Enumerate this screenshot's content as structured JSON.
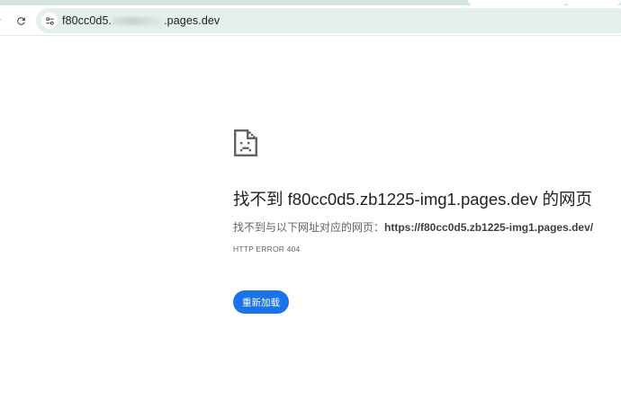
{
  "browser": {
    "url_prefix": "f80cc0d5.",
    "url_suffix": ".pages.dev"
  },
  "error_page": {
    "title": "找不到 f80cc0d5.zb1225-img1.pages.dev 的网页",
    "description_prefix": "找不到与以下网址对应的网页：",
    "description_url": "https://f80cc0d5.zb1225-img1.pages.dev/",
    "error_code": "HTTP ERROR 404",
    "reload_label": "重新加载"
  },
  "colors": {
    "accent": "#1a73e8",
    "omnibox_bg": "#e4efeb",
    "tabstrip_bg": "#d3e3dd"
  },
  "icons": {
    "reload": "reload-icon",
    "site_info": "site-info-icon",
    "error": "sad-file-icon"
  }
}
